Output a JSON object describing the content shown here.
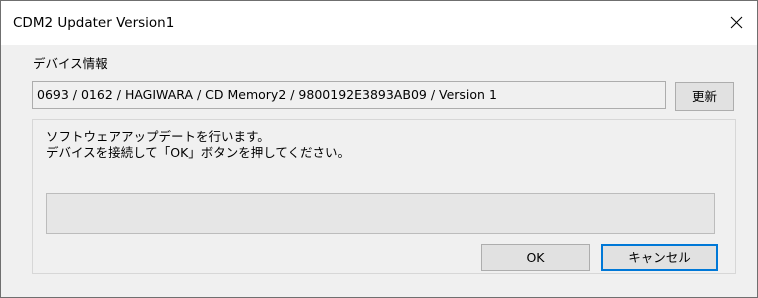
{
  "window": {
    "title": "CDM2 Updater Version1",
    "close_icon": "close-icon"
  },
  "device": {
    "label": "デバイス情報",
    "info_value": "0693 / 0162 / HAGIWARA / CD Memory2 / 9800192E3893AB09 / Version 1",
    "update_button": "更新"
  },
  "message": {
    "line1": "ソフトウェアアップデートを行います。",
    "line2": "デバイスを接続して「OK」ボタンを押してください。"
  },
  "progress": {
    "value": 0
  },
  "buttons": {
    "ok": "OK",
    "cancel": "キャンセル"
  },
  "colors": {
    "focus_border": "#0078d7",
    "button_face": "#e1e1e1",
    "dialog_background": "#f0f0f0",
    "title_background": "#ffffff"
  }
}
